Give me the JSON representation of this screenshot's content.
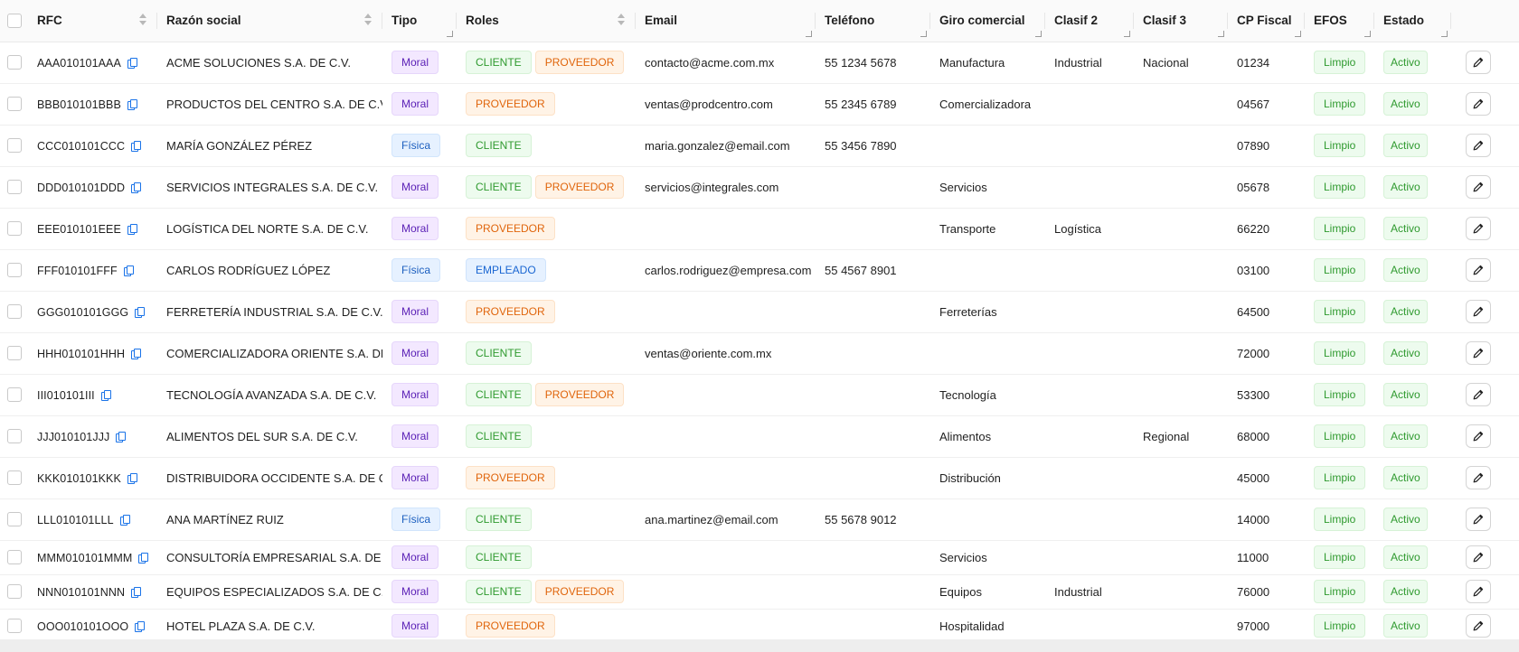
{
  "columns": {
    "rfc": "RFC",
    "razon": "Razón social",
    "tipo": "Tipo",
    "roles": "Roles",
    "email": "Email",
    "telefono": "Teléfono",
    "giro": "Giro comercial",
    "clasif2": "Clasif 2",
    "clasif3": "Clasif 3",
    "cp": "CP Fiscal",
    "efos": "EFOS",
    "estado": "Estado"
  },
  "icons": {
    "copy": "copy-icon",
    "edit": "pencil-icon",
    "sort": "sort-icon"
  },
  "colors": {
    "moral": "#5b21b6",
    "fisica": "#1d5fbf",
    "cliente": "#2f9a2f",
    "proveedor": "#e0650c",
    "empleado": "#1a66d2",
    "copy_icon": "#1a73e8"
  },
  "rows": [
    {
      "rfc": "AAA010101AAA",
      "razon": "ACME SOLUCIONES S.A. DE C.V.",
      "tipo": "Moral",
      "roles": [
        "CLIENTE",
        "PROVEEDOR"
      ],
      "email": "contacto@acme.com.mx",
      "telefono": "55 1234 5678",
      "giro": "Manufactura",
      "clasif2": "Industrial",
      "clasif3": "Nacional",
      "cp": "01234",
      "efos": "Limpio",
      "estado": "Activo"
    },
    {
      "rfc": "BBB010101BBB",
      "razon": "PRODUCTOS DEL CENTRO S.A. DE C.V.",
      "tipo": "Moral",
      "roles": [
        "PROVEEDOR"
      ],
      "email": "ventas@prodcentro.com",
      "telefono": "55 2345 6789",
      "giro": "Comercializadora",
      "clasif2": "",
      "clasif3": "",
      "cp": "04567",
      "efos": "Limpio",
      "estado": "Activo"
    },
    {
      "rfc": "CCC010101CCC",
      "razon": "MARÍA GONZÁLEZ PÉREZ",
      "tipo": "Física",
      "roles": [
        "CLIENTE"
      ],
      "email": "maria.gonzalez@email.com",
      "telefono": "55 3456 7890",
      "giro": "",
      "clasif2": "",
      "clasif3": "",
      "cp": "07890",
      "efos": "Limpio",
      "estado": "Activo"
    },
    {
      "rfc": "DDD010101DDD",
      "razon": "SERVICIOS INTEGRALES S.A. DE C.V.",
      "tipo": "Moral",
      "roles": [
        "CLIENTE",
        "PROVEEDOR"
      ],
      "email": "servicios@integrales.com",
      "telefono": "",
      "giro": "Servicios",
      "clasif2": "",
      "clasif3": "",
      "cp": "05678",
      "efos": "Limpio",
      "estado": "Activo"
    },
    {
      "rfc": "EEE010101EEE",
      "razon": "LOGÍSTICA DEL NORTE S.A. DE C.V.",
      "tipo": "Moral",
      "roles": [
        "PROVEEDOR"
      ],
      "email": "",
      "telefono": "",
      "giro": "Transporte",
      "clasif2": "Logística",
      "clasif3": "",
      "cp": "66220",
      "efos": "Limpio",
      "estado": "Activo"
    },
    {
      "rfc": "FFF010101FFF",
      "razon": "CARLOS RODRÍGUEZ LÓPEZ",
      "tipo": "Física",
      "roles": [
        "EMPLEADO"
      ],
      "email": "carlos.rodriguez@empresa.com",
      "telefono": "55 4567 8901",
      "giro": "",
      "clasif2": "",
      "clasif3": "",
      "cp": "03100",
      "efos": "Limpio",
      "estado": "Activo"
    },
    {
      "rfc": "GGG010101GGG",
      "razon": "FERRETERÍA INDUSTRIAL S.A. DE C.V.",
      "tipo": "Moral",
      "roles": [
        "PROVEEDOR"
      ],
      "email": "",
      "telefono": "",
      "giro": "Ferreterías",
      "clasif2": "",
      "clasif3": "",
      "cp": "64500",
      "efos": "Limpio",
      "estado": "Activo"
    },
    {
      "rfc": "HHH010101HHH",
      "razon": "COMERCIALIZADORA ORIENTE S.A. DE C.V.",
      "tipo": "Moral",
      "roles": [
        "CLIENTE"
      ],
      "email": "ventas@oriente.com.mx",
      "telefono": "",
      "giro": "",
      "clasif2": "",
      "clasif3": "",
      "cp": "72000",
      "efos": "Limpio",
      "estado": "Activo"
    },
    {
      "rfc": "III010101III",
      "razon": "TECNOLOGÍA AVANZADA S.A. DE C.V.",
      "tipo": "Moral",
      "roles": [
        "CLIENTE",
        "PROVEEDOR"
      ],
      "email": "",
      "telefono": "",
      "giro": "Tecnología",
      "clasif2": "",
      "clasif3": "",
      "cp": "53300",
      "efos": "Limpio",
      "estado": "Activo"
    },
    {
      "rfc": "JJJ010101JJJ",
      "razon": "ALIMENTOS DEL SUR S.A. DE C.V.",
      "tipo": "Moral",
      "roles": [
        "CLIENTE"
      ],
      "email": "",
      "telefono": "",
      "giro": "Alimentos",
      "clasif2": "",
      "clasif3": "Regional",
      "cp": "68000",
      "efos": "Limpio",
      "estado": "Activo"
    },
    {
      "rfc": "KKK010101KKK",
      "razon": "DISTRIBUIDORA OCCIDENTE S.A. DE C.V.",
      "tipo": "Moral",
      "roles": [
        "PROVEEDOR"
      ],
      "email": "",
      "telefono": "",
      "giro": "Distribución",
      "clasif2": "",
      "clasif3": "",
      "cp": "45000",
      "efos": "Limpio",
      "estado": "Activo"
    },
    {
      "rfc": "LLL010101LLL",
      "razon": "ANA MARTÍNEZ RUIZ",
      "tipo": "Física",
      "roles": [
        "CLIENTE"
      ],
      "email": "ana.martinez@email.com",
      "telefono": "55 5678 9012",
      "giro": "",
      "clasif2": "",
      "clasif3": "",
      "cp": "14000",
      "efos": "Limpio",
      "estado": "Activo"
    },
    {
      "rfc": "MMM010101MMM",
      "razon": "CONSULTORÍA EMPRESARIAL S.A. DE C.V.",
      "tipo": "Moral",
      "roles": [
        "CLIENTE"
      ],
      "email": "",
      "telefono": "",
      "giro": "Servicios",
      "clasif2": "",
      "clasif3": "",
      "cp": "11000",
      "efos": "Limpio",
      "estado": "Activo"
    },
    {
      "rfc": "NNN010101NNN",
      "razon": "EQUIPOS ESPECIALIZADOS S.A. DE C.V.",
      "tipo": "Moral",
      "roles": [
        "CLIENTE",
        "PROVEEDOR"
      ],
      "email": "",
      "telefono": "",
      "giro": "Equipos",
      "clasif2": "Industrial",
      "clasif3": "",
      "cp": "76000",
      "efos": "Limpio",
      "estado": "Activo"
    },
    {
      "rfc": "OOO010101OOO",
      "razon": "HOTEL PLAZA S.A. DE C.V.",
      "tipo": "Moral",
      "roles": [
        "PROVEEDOR"
      ],
      "email": "",
      "telefono": "",
      "giro": "Hospitalidad",
      "clasif2": "",
      "clasif3": "",
      "cp": "97000",
      "efos": "Limpio",
      "estado": "Activo"
    }
  ]
}
